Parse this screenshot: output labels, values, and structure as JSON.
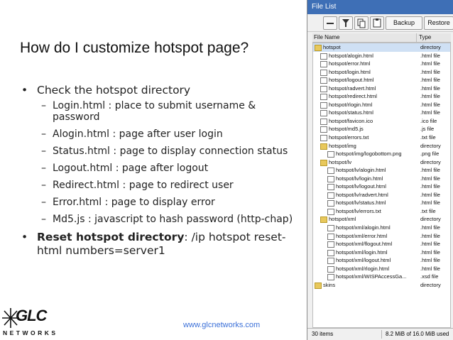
{
  "slide": {
    "title": "How do I customize hotspot page?",
    "bullet1": "Check the hotspot directory",
    "subitems": [
      "Login.html : place to submit username & password",
      "Alogin.html : page after user login",
      "Status.html : page to display connection status",
      "Logout.html : page after logout",
      "Redirect.html : page to redirect user",
      "Error.html : page to display error",
      "Md5.js : javascript to hash password (http-chap)"
    ],
    "bullet2_strong": "Reset hotspot directory",
    "bullet2_rest": ": /ip hotspot reset-html numbers=server1",
    "bullet_char": "•",
    "dash_char": "–",
    "url": "www.glcnetworks.com",
    "logo_text": "GLC",
    "logo_sub": "NETWORKS"
  },
  "window": {
    "title": "File List",
    "toolbar": {
      "backup": "Backup",
      "restore": "Restore",
      "dropdown": "▼"
    },
    "columns": {
      "name": "File Name",
      "type": "Type"
    },
    "files": [
      {
        "name": "hotspot",
        "type": "directory",
        "kind": "folder",
        "indent": 0,
        "selected": true
      },
      {
        "name": "hotspot/alogin.html",
        "type": ".html file",
        "kind": "file",
        "indent": 1
      },
      {
        "name": "hotspot/error.html",
        "type": ".html file",
        "kind": "file",
        "indent": 1
      },
      {
        "name": "hotspot/login.html",
        "type": ".html file",
        "kind": "file",
        "indent": 1
      },
      {
        "name": "hotspot/logout.html",
        "type": ".html file",
        "kind": "file",
        "indent": 1
      },
      {
        "name": "hotspot/radvert.html",
        "type": ".html file",
        "kind": "file",
        "indent": 1
      },
      {
        "name": "hotspot/redirect.html",
        "type": ".html file",
        "kind": "file",
        "indent": 1
      },
      {
        "name": "hotspot/rlogin.html",
        "type": ".html file",
        "kind": "file",
        "indent": 1
      },
      {
        "name": "hotspot/status.html",
        "type": ".html file",
        "kind": "file",
        "indent": 1
      },
      {
        "name": "hotspot/favicon.ico",
        "type": ".ico file",
        "kind": "file",
        "indent": 1
      },
      {
        "name": "hotspot/md5.js",
        "type": ".js file",
        "kind": "file",
        "indent": 1
      },
      {
        "name": "hotspot/errors.txt",
        "type": ".txt file",
        "kind": "file",
        "indent": 1
      },
      {
        "name": "hotspot/img",
        "type": "directory",
        "kind": "folder",
        "indent": 1
      },
      {
        "name": "hotspot/img/logobottom.png",
        "type": ".png file",
        "kind": "file",
        "indent": 2
      },
      {
        "name": "hotspot/lv",
        "type": "directory",
        "kind": "folder",
        "indent": 1
      },
      {
        "name": "hotspot/lv/alogin.html",
        "type": ".html file",
        "kind": "file",
        "indent": 2
      },
      {
        "name": "hotspot/lv/login.html",
        "type": ".html file",
        "kind": "file",
        "indent": 2
      },
      {
        "name": "hotspot/lv/logout.html",
        "type": ".html file",
        "kind": "file",
        "indent": 2
      },
      {
        "name": "hotspot/lv/radvert.html",
        "type": ".html file",
        "kind": "file",
        "indent": 2
      },
      {
        "name": "hotspot/lv/status.html",
        "type": ".html file",
        "kind": "file",
        "indent": 2
      },
      {
        "name": "hotspot/lv/errors.txt",
        "type": ".txt file",
        "kind": "file",
        "indent": 2
      },
      {
        "name": "hotspot/xml",
        "type": "directory",
        "kind": "folder",
        "indent": 1
      },
      {
        "name": "hotspot/xml/alogin.html",
        "type": ".html file",
        "kind": "file",
        "indent": 2
      },
      {
        "name": "hotspot/xml/error.html",
        "type": ".html file",
        "kind": "file",
        "indent": 2
      },
      {
        "name": "hotspot/xml/flogout.html",
        "type": ".html file",
        "kind": "file",
        "indent": 2
      },
      {
        "name": "hotspot/xml/login.html",
        "type": ".html file",
        "kind": "file",
        "indent": 2
      },
      {
        "name": "hotspot/xml/logout.html",
        "type": ".html file",
        "kind": "file",
        "indent": 2
      },
      {
        "name": "hotspot/xml/rlogin.html",
        "type": ".html file",
        "kind": "file",
        "indent": 2
      },
      {
        "name": "hotspot/xml/WISPAccessGa...",
        "type": ".xsd file",
        "kind": "file",
        "indent": 2
      },
      {
        "name": "skins",
        "type": "directory",
        "kind": "folder",
        "indent": 0
      }
    ],
    "status": {
      "count": "30 items",
      "space": "8.2 MiB of 16.0 MiB used"
    }
  }
}
